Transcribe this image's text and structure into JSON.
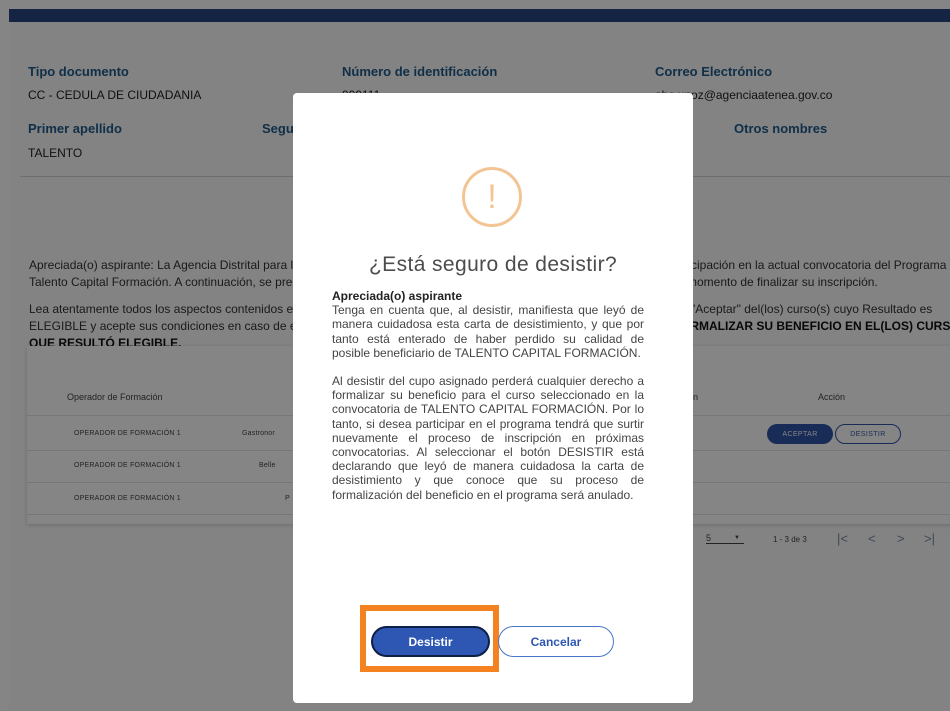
{
  "profile": {
    "tipo_documento_label": "Tipo documento",
    "tipo_documento_value": "CC - CEDULA DE CIUDADANIA",
    "numero_label": "Número de identificación",
    "numero_value": "999111",
    "correo_label": "Correo Electrónico",
    "correo_value": "abc.unoz@agenciaatenea.gov.co",
    "primer_apellido_label": "Primer apellido",
    "primer_apellido_value": "TALENTO",
    "segundo_apellido_label": "Segu",
    "otros_nombres_label": "Otros nombres"
  },
  "intro": {
    "line1_left": "Apreciada(o) aspirante: La Agencia Distrital para la",
    "line1_right": "rticipación en la actual convocatoria del Programa",
    "line2_left": "Talento Capital Formación. A continuación, se prese",
    "line2_right": "l momento de finalizar su inscripción.",
    "line3_left": "Lea atentamente todos los aspectos contenidos en",
    "line3_right": "n \"Aceptar\" del(los) curso(s) cuyo Resultado es",
    "line4_left": "ELEGIBLE y acepte sus condiciones en caso de esta",
    "line4_right": "ORMALIZAR SU BENEFICIO EN EL(LOS) CURSO(S)",
    "line5_left": "QUE RESULTÓ ELEGIBLE."
  },
  "table": {
    "headers": {
      "operador": "Operador de Formación",
      "observacion": "rvación",
      "accion": "Acción"
    },
    "rows": [
      {
        "operador": "OPERADOR DE FORMACIÓN 1",
        "curso": "Gastronor"
      },
      {
        "operador": "OPERADOR DE FORMACIÓN 1",
        "curso": "Belle"
      },
      {
        "operador": "OPERADOR DE FORMACIÓN 1",
        "curso": "P"
      }
    ],
    "accept_label": "ACEPTAR",
    "desist_label": "DESISTIR",
    "pager": {
      "per_page_prefix": "o",
      "per_page_value": "5",
      "range": "1 - 3 de 3",
      "first": "|<",
      "prev": "<",
      "next": ">",
      "last": ">|",
      "dropdown_icon": "▼"
    }
  },
  "modal": {
    "icon_symbol": "!",
    "title": "¿Está seguro de desistir?",
    "lead": "Apreciada(o) aspirante",
    "paragraph1": "Tenga en cuenta que, al desistir, manifiesta que leyó de manera cuidadosa esta carta de desistimiento, y que por tanto está enterado de haber perdido su calidad de posible beneficiario de TALENTO CAPITAL FORMACIÓN.",
    "paragraph2": "Al desistir del cupo asignado perderá cualquier derecho a formalizar su beneficio para el curso seleccionado en la convocatoria de TALENTO CAPITAL FORMACIÓN. Por lo tanto, si desea participar en el programa tendrá que surtir nuevamente el proceso de inscripción en próximas convocatorias. Al seleccionar el botón DESISTIR está declarando que leyó de manera cuidadosa la carta de desistimiento y que conoce que su proceso de formalización del beneficio en el programa será anulado.",
    "confirm_label": "Desistir",
    "cancel_label": "Cancelar"
  },
  "colors": {
    "header_bar": "#27457f",
    "label_blue": "#1f5a8a",
    "primary_button": "#2d57b2",
    "warning_icon": "#f3c494",
    "highlight_box": "#f58220"
  }
}
